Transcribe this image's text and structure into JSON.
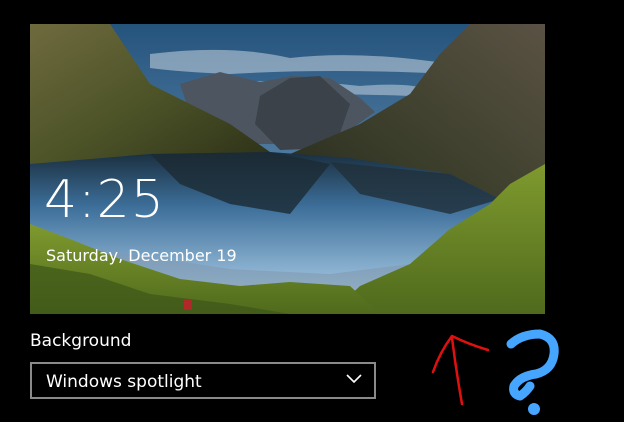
{
  "lockscreen_preview": {
    "time": "4:25",
    "date": "Saturday, December 19"
  },
  "background_setting": {
    "label": "Background",
    "selected_value": "Windows spotlight",
    "dropdown_icon": "chevron-down-icon"
  },
  "annotations": {
    "arrow_color": "#e01010",
    "question_mark_color": "#46a6ff"
  }
}
